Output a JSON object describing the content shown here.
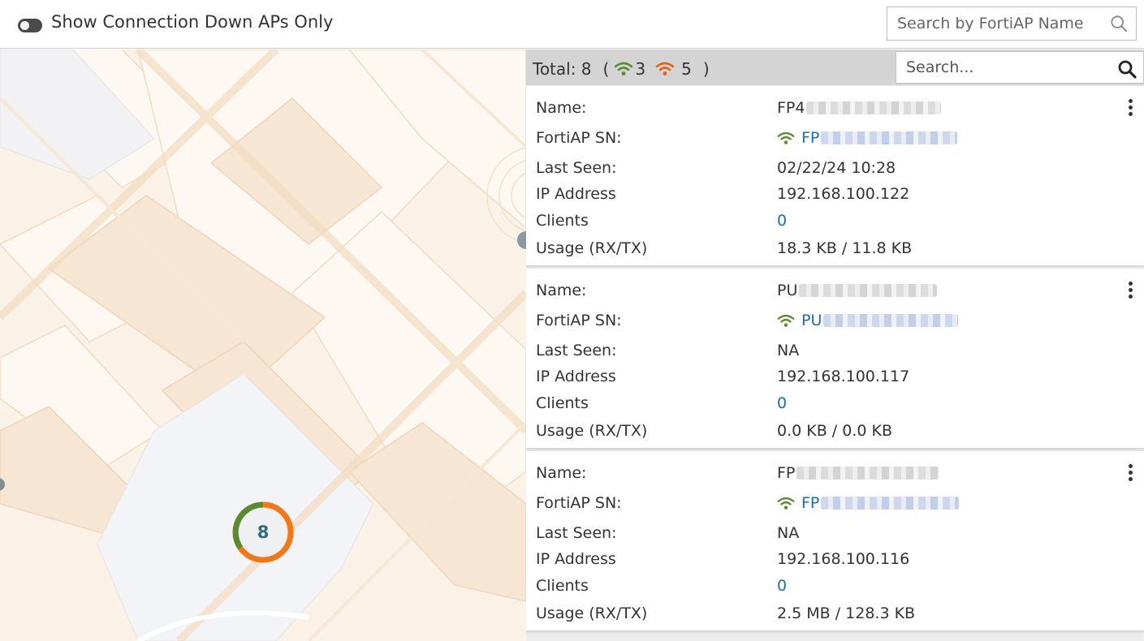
{
  "topbar": {
    "toggle_label": "Show Connection Down APs Only",
    "search_placeholder": "Search by FortiAP Name"
  },
  "map": {
    "cluster_count": "8",
    "cluster_colors": {
      "up": "#5a8a32",
      "down": "#f07818"
    }
  },
  "panel": {
    "total_label": "Total: 8",
    "open_paren": "(",
    "close_paren": ")",
    "up_count": "3",
    "down_count": "5",
    "up_color": "#5a8a32",
    "down_color": "#e0621a",
    "search_placeholder": "Search..."
  },
  "labels": {
    "name": "Name:",
    "sn": "FortiAP SN:",
    "last_seen": "Last Seen:",
    "ip": "IP Address",
    "clients": "Clients",
    "usage": "Usage (RX/TX)"
  },
  "aps": [
    {
      "name_prefix": "FP4",
      "sn_prefix": "FP",
      "last_seen": "02/22/24 10:28",
      "ip": "192.168.100.122",
      "clients": "0",
      "usage": "18.3 KB / 11.8 KB"
    },
    {
      "name_prefix": "PU",
      "sn_prefix": "PU",
      "last_seen": "NA",
      "ip": "192.168.100.117",
      "clients": "0",
      "usage": "0.0 KB / 0.0 KB"
    },
    {
      "name_prefix": "FP",
      "sn_prefix": "FP",
      "last_seen": "NA",
      "ip": "192.168.100.116",
      "clients": "0",
      "usage": "2.5 MB / 128.3 KB"
    }
  ]
}
